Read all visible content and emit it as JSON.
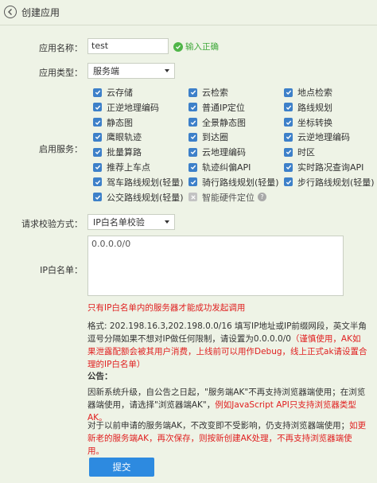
{
  "header": {
    "title": "创建应用"
  },
  "form": {
    "app_name_label": "应用名称：",
    "app_name_value": "test",
    "app_name_valid": "输入正确",
    "app_type_label": "应用类型：",
    "app_type_value": "服务端",
    "services_label": "启用服务：",
    "services": [
      {
        "label": "云存储",
        "checked": true,
        "disabled": false
      },
      {
        "label": "云检索",
        "checked": true,
        "disabled": false
      },
      {
        "label": "地点检索",
        "checked": true,
        "disabled": false
      },
      {
        "label": "正逆地理编码",
        "checked": true,
        "disabled": false
      },
      {
        "label": "普通IP定位",
        "checked": true,
        "disabled": false
      },
      {
        "label": "路线规划",
        "checked": true,
        "disabled": false
      },
      {
        "label": "静态图",
        "checked": true,
        "disabled": false
      },
      {
        "label": "全景静态图",
        "checked": true,
        "disabled": false
      },
      {
        "label": "坐标转换",
        "checked": true,
        "disabled": false
      },
      {
        "label": "鹰眼轨迹",
        "checked": true,
        "disabled": false
      },
      {
        "label": "到达圈",
        "checked": true,
        "disabled": false
      },
      {
        "label": "云逆地理编码",
        "checked": true,
        "disabled": false
      },
      {
        "label": "批量算路",
        "checked": true,
        "disabled": false
      },
      {
        "label": "云地理编码",
        "checked": true,
        "disabled": false
      },
      {
        "label": "时区",
        "checked": true,
        "disabled": false
      },
      {
        "label": "推荐上车点",
        "checked": true,
        "disabled": false
      },
      {
        "label": "轨迹纠偏API",
        "checked": true,
        "disabled": false
      },
      {
        "label": "实时路况查询API",
        "checked": true,
        "disabled": false
      },
      {
        "label": "驾车路线规划(轻量)",
        "checked": true,
        "disabled": false
      },
      {
        "label": "骑行路线规划(轻量)",
        "checked": true,
        "disabled": false
      },
      {
        "label": "步行路线规划(轻量)",
        "checked": true,
        "disabled": false
      },
      {
        "label": "公交路线规划(轻量)",
        "checked": true,
        "disabled": false
      },
      {
        "label": "智能硬件定位",
        "checked": false,
        "disabled": true
      }
    ],
    "verify_label": "请求校验方式：",
    "verify_value": "IP白名单校验",
    "ip_label": "IP白名单：",
    "ip_value": "0.0.0.0/0",
    "ip_warning": "只有IP白名单内的服务器才能成功发起调用",
    "format_text": "格式: 202.198.16.3,202.198.0.0/16 填写IP地址或IP前缀网段，英文半角逗号分隔如果不想对IP做任何限制，请设置为0.0.0.0/0",
    "format_warning": "（谨慎使用，AK如果泄露配额会被其用户消费，上线前可以用作Debug，线上正式ak请设置合理的IP白名单）",
    "notice_title": "公告：",
    "notice_text_1": "因新系统升级，自公告之日起，\"服务端AK\"不再支持浏览器端使用；在浏览器端使用，请选择\"浏览器端AK\"，",
    "notice_text_1_red": "例如JavaScript API只支持浏览器类型AK。",
    "notice_text_2": "对于以前申请的服务端AK，不改变即不受影响，仍支持浏览器端使用；",
    "notice_text_2_red": "如更新老的服务端AK，再次保存，则按新创建AK处理，不再支持浏览器端使用。",
    "submit_label": "提交"
  },
  "colors": {
    "background": "#eef3e6",
    "checkbox": "#3d80c9",
    "valid": "#3fa83a",
    "warning": "#e02020",
    "submit": "#2d8ae0"
  }
}
